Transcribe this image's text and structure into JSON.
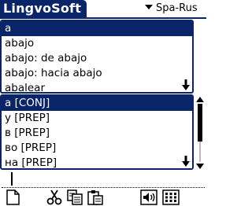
{
  "app": {
    "title": "LingvoSoft"
  },
  "language_selector": {
    "value": "Spa-Rus"
  },
  "word_list": {
    "items": [
      {
        "label": "a",
        "selected": true
      },
      {
        "label": "abajo",
        "selected": false
      },
      {
        "label": "abajo: de abajo",
        "selected": false
      },
      {
        "label": "abajo: hacia abajo",
        "selected": false
      },
      {
        "label": "abalear",
        "selected": false
      }
    ]
  },
  "translations": {
    "items": [
      {
        "label": "a [CONJ]",
        "selected": true
      },
      {
        "label": "у [PREP]",
        "selected": false
      },
      {
        "label": "в [PREP]",
        "selected": false
      },
      {
        "label": "во [PREP]",
        "selected": false
      },
      {
        "label": "на [PREP]",
        "selected": false
      }
    ]
  },
  "input": {
    "value": ""
  },
  "toolbar": {
    "icons": [
      "new-document-icon",
      "cut-icon",
      "copy-icon",
      "paste-icon",
      "speaker-icon",
      "grid-icon"
    ]
  },
  "colors": {
    "accent": "#0a246a",
    "background": "#ffffff",
    "text": "#000000",
    "selected_text": "#ffffff"
  }
}
